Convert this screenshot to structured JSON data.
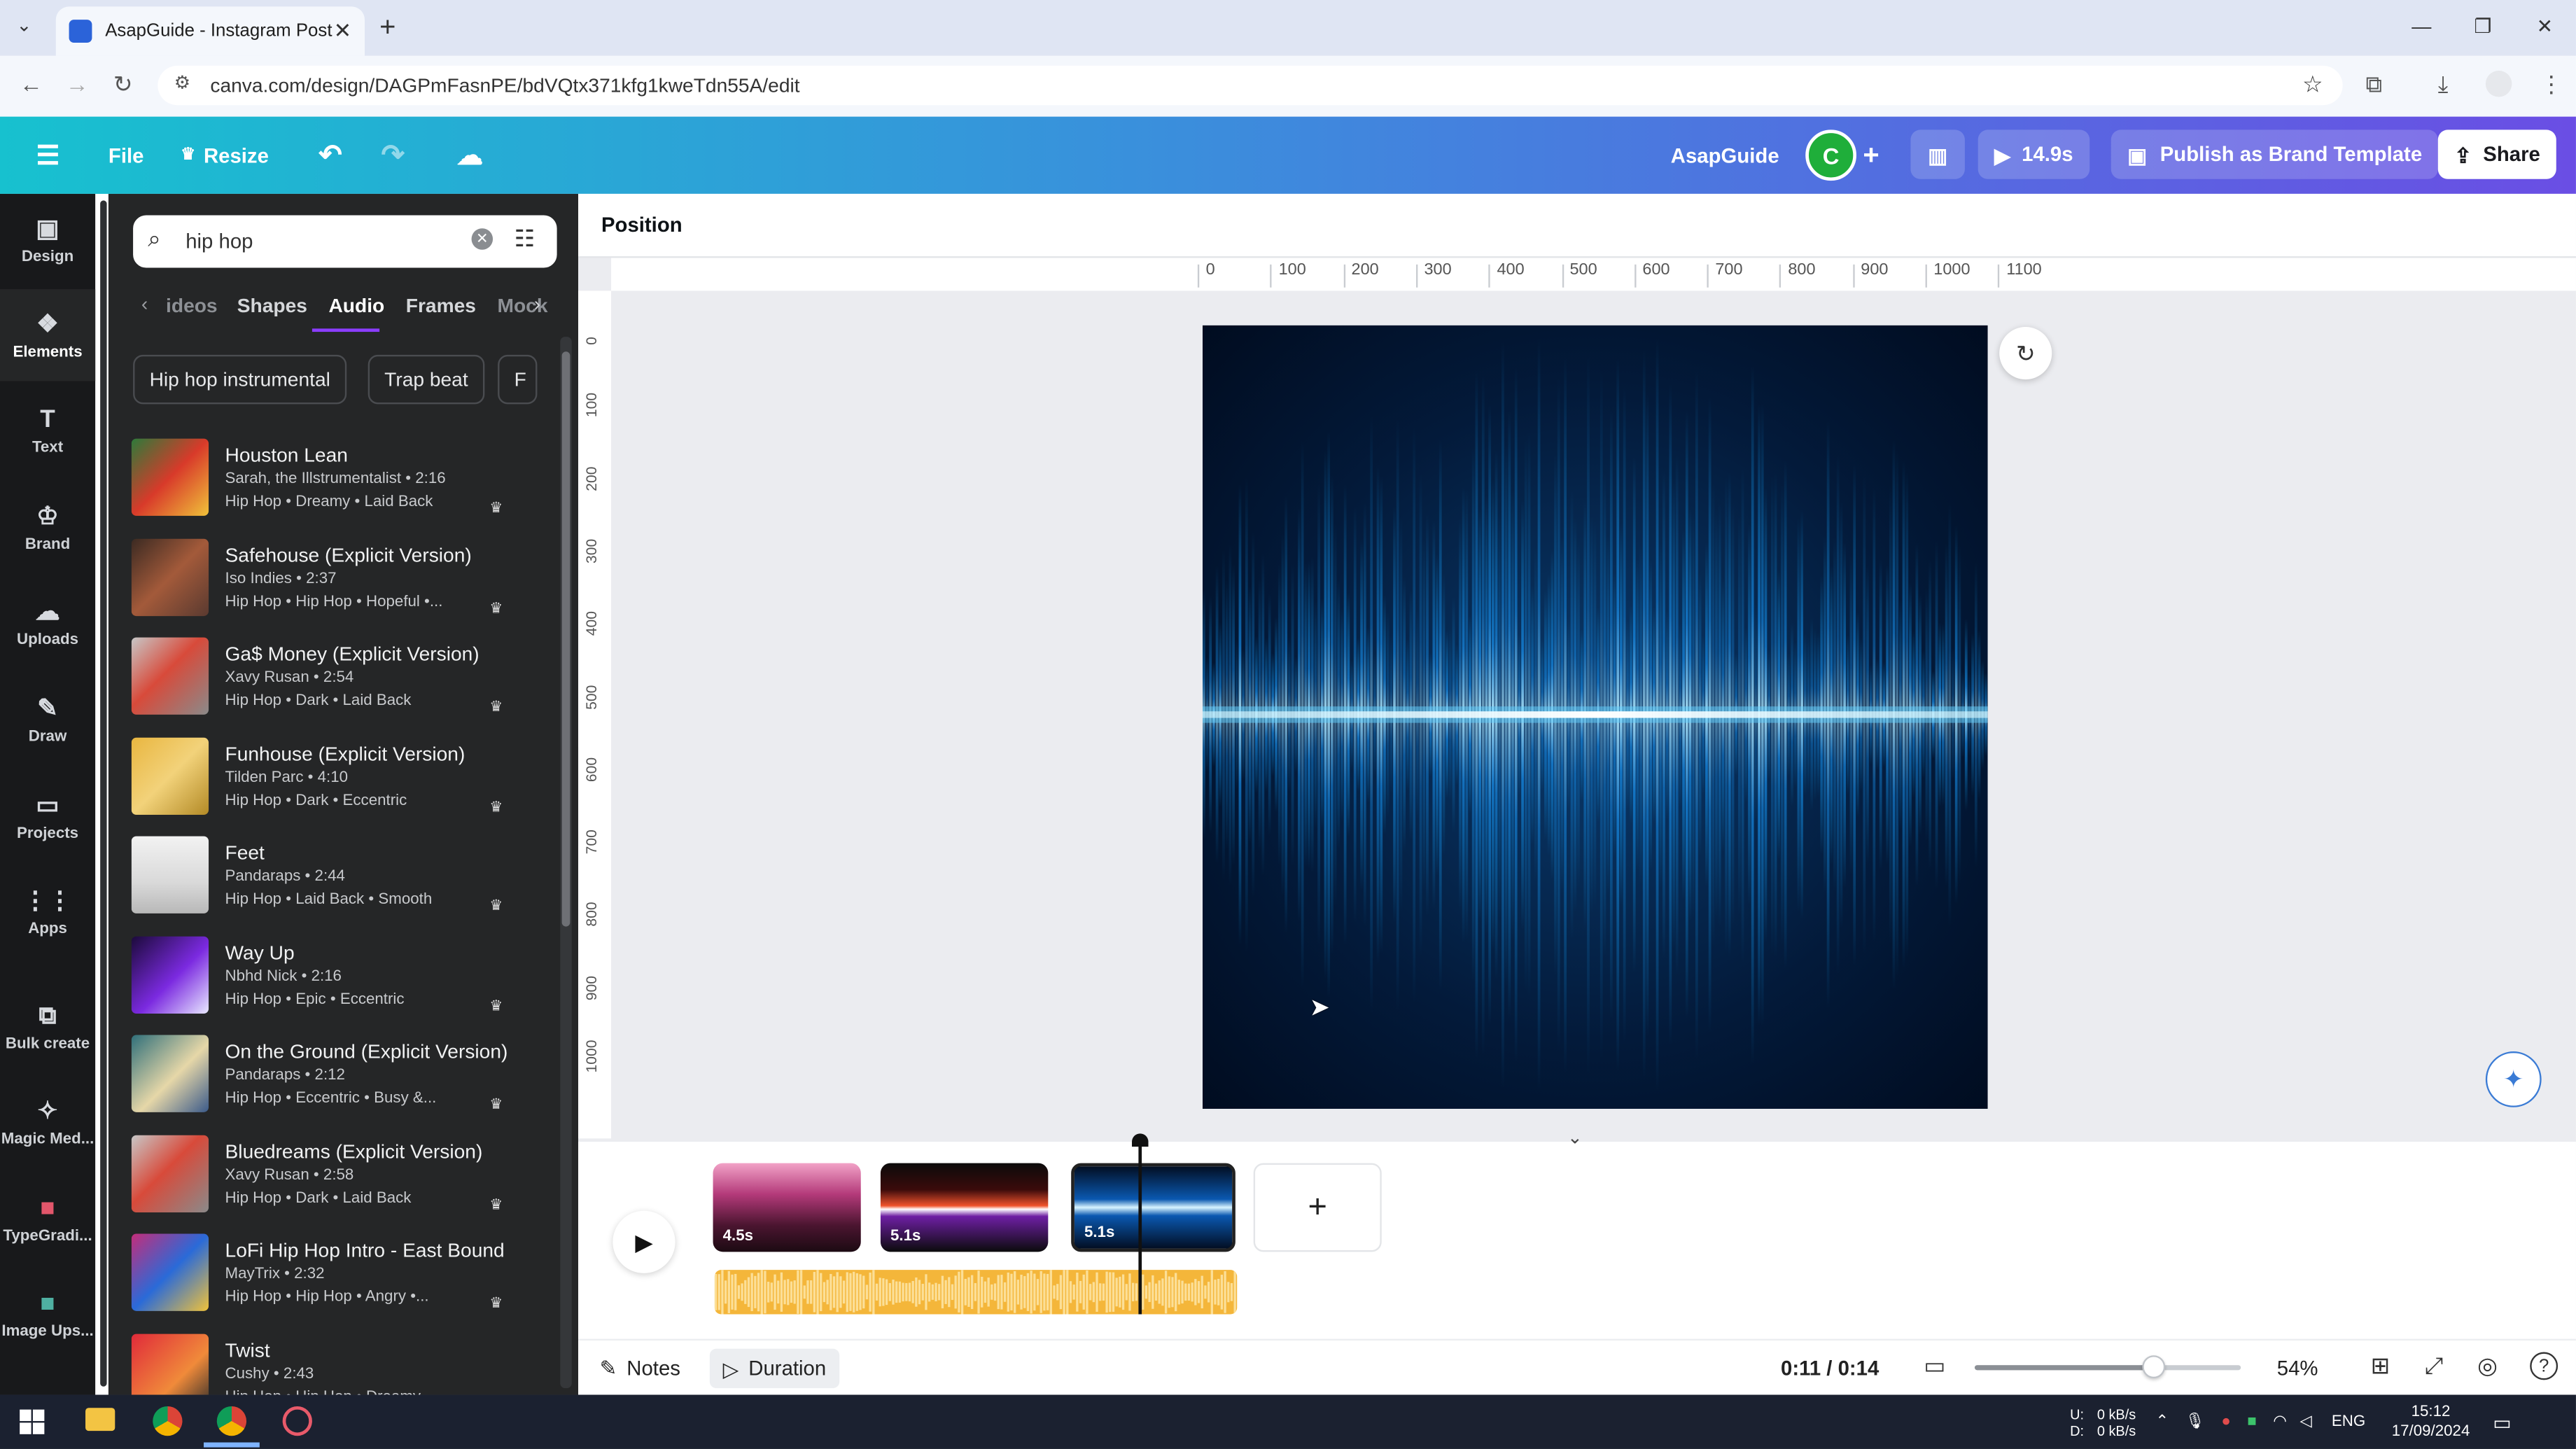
{
  "browser": {
    "tab_title": "AsapGuide - Instagram Post",
    "url": "canva.com/design/DAGPmFasnPE/bdVQtx371kfg1kweTdn55A/edit"
  },
  "header": {
    "file": "File",
    "resize": "Resize",
    "brand_name": "AsapGuide",
    "avatar_letter": "C",
    "play_duration": "14.9s",
    "publish": "Publish as Brand Template",
    "share": "Share"
  },
  "rail": [
    {
      "label": "Design",
      "icon": "layout-icon"
    },
    {
      "label": "Elements",
      "icon": "shapes-icon"
    },
    {
      "label": "Text",
      "icon": "text-icon"
    },
    {
      "label": "Brand",
      "icon": "brand-icon"
    },
    {
      "label": "Uploads",
      "icon": "cloud-upload-icon"
    },
    {
      "label": "Draw",
      "icon": "pen-icon"
    },
    {
      "label": "Projects",
      "icon": "folder-icon"
    },
    {
      "label": "Apps",
      "icon": "grid-icon"
    },
    {
      "label": "Bulk create",
      "icon": "bulk-icon"
    },
    {
      "label": "Magic Med...",
      "icon": "magic-icon"
    },
    {
      "label": "TypeGradi...",
      "icon": "app-icon"
    },
    {
      "label": "Image Ups...",
      "icon": "app-icon"
    }
  ],
  "panel": {
    "search_value": "hip hop",
    "tabs": [
      "ideos",
      "Shapes",
      "Audio",
      "Frames",
      "Mock"
    ],
    "active_tab": "Audio",
    "chips": [
      "Hip hop instrumental",
      "Trap beat",
      "F"
    ],
    "tracks": [
      {
        "title": "Houston Lean",
        "meta": "Sarah, the Illstrumentalist • 2:16",
        "tags": "Hip Hop • Dreamy • Laid Back"
      },
      {
        "title": "Safehouse (Explicit Version)",
        "meta": "Iso Indies • 2:37",
        "tags": "Hip Hop • Hip Hop • Hopeful •..."
      },
      {
        "title": "Ga$ Money (Explicit Version)",
        "meta": "Xavy Rusan • 2:54",
        "tags": "Hip Hop • Dark • Laid Back"
      },
      {
        "title": "Funhouse (Explicit Version)",
        "meta": "Tilden Parc • 4:10",
        "tags": "Hip Hop • Dark • Eccentric"
      },
      {
        "title": "Feet",
        "meta": "Pandaraps • 2:44",
        "tags": "Hip Hop • Laid Back • Smooth"
      },
      {
        "title": "Way Up",
        "meta": "Nbhd Nick • 2:16",
        "tags": "Hip Hop • Epic • Eccentric"
      },
      {
        "title": "On the Ground (Explicit Version)",
        "meta": "Pandaraps • 2:12",
        "tags": "Hip Hop • Eccentric • Busy &..."
      },
      {
        "title": "Bluedreams (Explicit Version)",
        "meta": "Xavy Rusan • 2:58",
        "tags": "Hip Hop • Dark • Laid Back"
      },
      {
        "title": "LoFi Hip Hop Intro - East Bound",
        "meta": "MayTrix • 2:32",
        "tags": "Hip Hop • Hip Hop • Angry •..."
      },
      {
        "title": "Twist",
        "meta": "Cushy • 2:43",
        "tags": "Hip Hop • Hip Hop • Dreamy"
      }
    ]
  },
  "editor": {
    "position_label": "Position",
    "ruler_h": [
      "0",
      "100",
      "200",
      "300",
      "400",
      "500",
      "600",
      "700",
      "800",
      "900",
      "1000",
      "1100"
    ],
    "ruler_v": [
      "0",
      "100",
      "200",
      "300",
      "400",
      "500",
      "600",
      "700",
      "800",
      "900",
      "1000"
    ]
  },
  "timeline": {
    "clips": [
      "4.5s",
      "5.1s",
      "5.1s"
    ],
    "add": "+"
  },
  "bottom": {
    "notes": "Notes",
    "duration": "Duration",
    "time": "0:11 / 0:14",
    "zoom": "54%"
  },
  "taskbar": {
    "net_up": "0 kB/s",
    "net_down": "0 kB/s",
    "lang": "ENG",
    "time": "15:12",
    "date": "17/09/2024"
  },
  "colors": {
    "header_start": "#17c1cf",
    "header_end": "#6a4ee4",
    "panel_bg": "#252627",
    "rail_bg": "#18191b",
    "accent": "#8b3dff"
  }
}
